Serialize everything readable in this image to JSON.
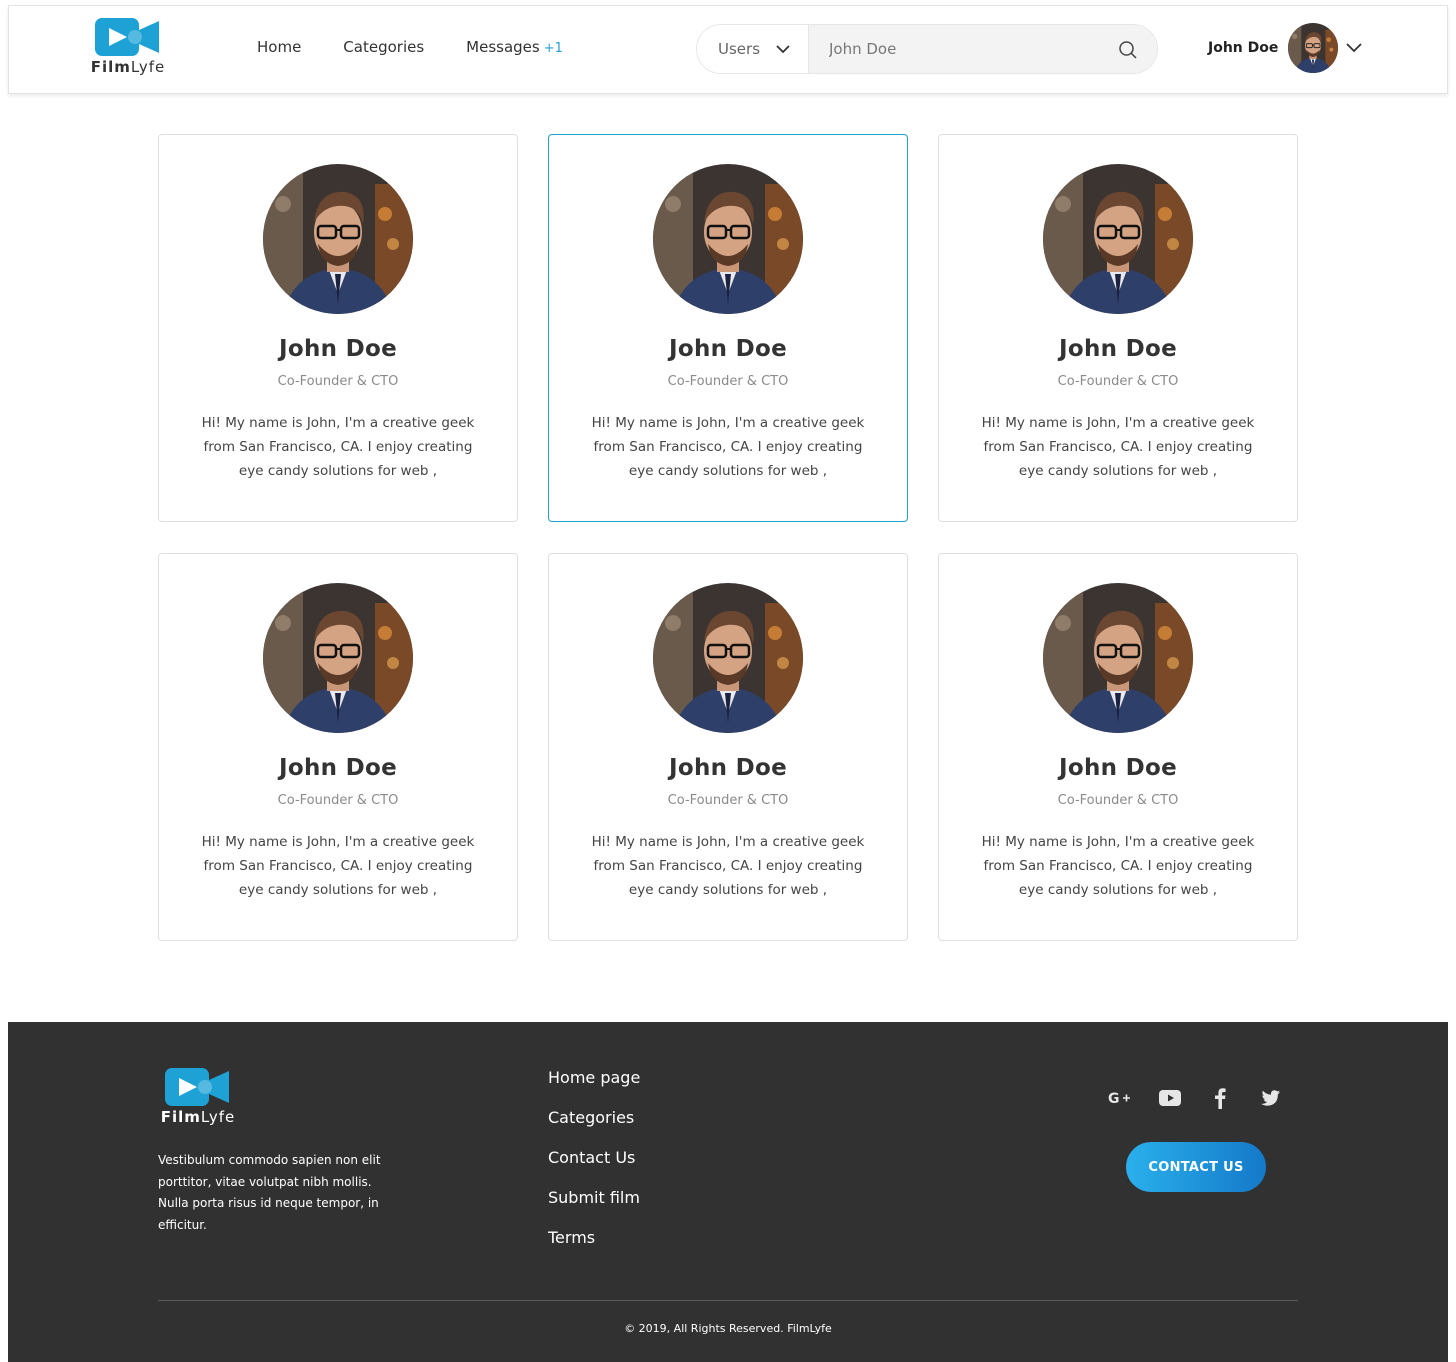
{
  "brand": {
    "name_bold": "Film",
    "name_light": "Lyfe",
    "accent": "#1ea2d6"
  },
  "nav": {
    "items": [
      {
        "label": "Home"
      },
      {
        "label": "Categories"
      },
      {
        "label": "Messages",
        "badge": "+1"
      }
    ]
  },
  "search": {
    "category": "Users",
    "value": "John Doe",
    "icon": "search-icon"
  },
  "user": {
    "name": "John Doe"
  },
  "cards": [
    {
      "name": "John Doe",
      "role": "Co-Founder & CTO",
      "bio": "Hi! My name is John, I'm a creative geek from San Francisco, CA. I enjoy creating eye candy solutions for web ,",
      "active": false
    },
    {
      "name": "John Doe",
      "role": "Co-Founder & CTO",
      "bio": "Hi! My name is John, I'm a creative geek from San Francisco, CA. I enjoy creating eye candy solutions for web ,",
      "active": true
    },
    {
      "name": "John Doe",
      "role": "Co-Founder & CTO",
      "bio": "Hi! My name is John, I'm a creative geek from San Francisco, CA. I enjoy creating eye candy solutions for web ,",
      "active": false
    },
    {
      "name": "John Doe",
      "role": "Co-Founder & CTO",
      "bio": "Hi! My name is John, I'm a creative geek from San Francisco, CA. I enjoy creating eye candy solutions for web ,",
      "active": false
    },
    {
      "name": "John Doe",
      "role": "Co-Founder & CTO",
      "bio": "Hi! My name is John, I'm a creative geek from San Francisco, CA. I enjoy creating eye candy solutions for web ,",
      "active": false
    },
    {
      "name": "John Doe",
      "role": "Co-Founder & CTO",
      "bio": "Hi! My name is John, I'm a creative geek from San Francisco, CA. I enjoy creating eye candy solutions for web ,",
      "active": false
    }
  ],
  "footer": {
    "about": "Vestibulum commodo sapien non elit porttitor, vitae volutpat nibh mollis. Nulla porta risus id neque tempor, in efficitur.",
    "links": [
      {
        "label": "Home page"
      },
      {
        "label": "Categories"
      },
      {
        "label": "Contact Us"
      },
      {
        "label": "Submit film"
      },
      {
        "label": "Terms"
      }
    ],
    "socials": [
      "google-plus-icon",
      "youtube-icon",
      "facebook-icon",
      "twitter-icon"
    ],
    "cta": "CONTACT US",
    "copyright": "© 2019, All Rights Reserved. FilmLyfe",
    "background": "#313131"
  }
}
